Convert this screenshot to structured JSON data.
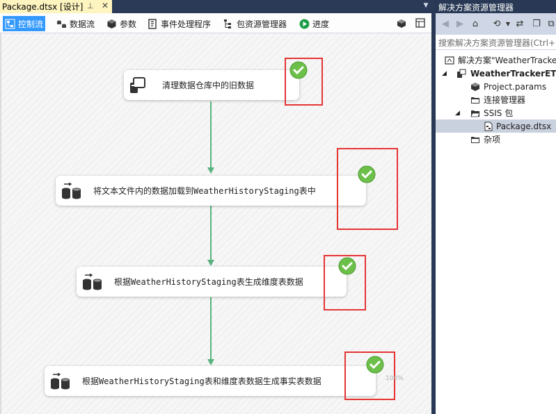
{
  "document": {
    "tab_title": "Package.dtsx [设计]",
    "pin_glyph": "⊥",
    "close_glyph": "✕"
  },
  "designer_tabs": [
    {
      "label": "控制流",
      "icon": "control-flow-icon",
      "active": true
    },
    {
      "label": "数据流",
      "icon": "data-flow-icon"
    },
    {
      "label": "参数",
      "icon": "parameters-icon"
    },
    {
      "label": "事件处理程序",
      "icon": "event-handlers-icon"
    },
    {
      "label": "包资源管理器",
      "icon": "package-explorer-icon"
    },
    {
      "label": "进度",
      "icon": "progress-icon"
    }
  ],
  "tasks": [
    {
      "label": "清理数据仓库中的旧数据",
      "icon": "execute-sql-task-icon",
      "status": "success"
    },
    {
      "label": "将文本文件内的数据加载到WeatherHistoryStaging表中",
      "icon": "data-flow-task-icon",
      "status": "success"
    },
    {
      "label": "根据WeatherHistoryStaging表生成维度表数据",
      "icon": "data-flow-task-icon",
      "status": "success"
    },
    {
      "label": "根据WeatherHistoryStaging表和维度表数据生成事实表数据",
      "icon": "data-flow-task-icon",
      "status": "success"
    }
  ],
  "zoom_label": "100%",
  "solution_explorer": {
    "title": "解决方案资源管理器",
    "search_placeholder": "搜索解决方案资源管理器(Ctrl+;)",
    "tree": [
      {
        "label": "解决方案\"WeatherTracker\"",
        "icon": "solution-icon",
        "level": 0
      },
      {
        "label": "WeatherTrackerETL",
        "icon": "ssis-project-icon",
        "level": 0,
        "expanded": true,
        "bold": true
      },
      {
        "label": "Project.params",
        "icon": "params-icon",
        "level": 1
      },
      {
        "label": "连接管理器",
        "icon": "folder-icon",
        "level": 1
      },
      {
        "label": "SSIS 包",
        "icon": "folder-open-icon",
        "level": 1,
        "expanded": true
      },
      {
        "label": "Package.dtsx",
        "icon": "package-file-icon",
        "level": 2,
        "selected": true
      },
      {
        "label": "杂项",
        "icon": "folder-icon",
        "level": 1
      }
    ]
  },
  "colors": {
    "accent": "#3399ff",
    "connector": "#57b27d",
    "success": "#5cb85c",
    "highlight_box": "#e53333",
    "title_bar": "#293955"
  }
}
